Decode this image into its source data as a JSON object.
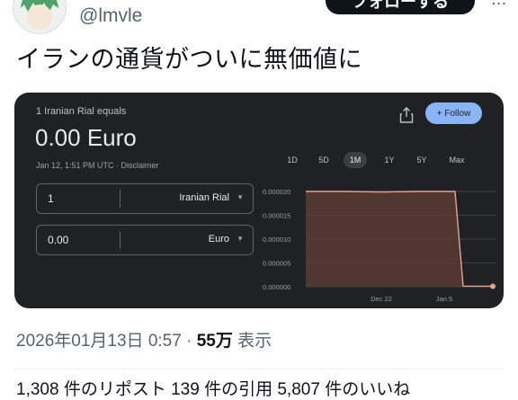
{
  "tweet": {
    "handle": "@lmvle",
    "follow_label": "フォローする",
    "text": "イランの通貨がついに無価値に",
    "timestamp": "2026年01月13日 0:57",
    "dot": "·",
    "views_count": "55万",
    "views_label": "表示",
    "stats_partial": "1,308 件のリポスト 139 件の引用 5,807 件のいいね"
  },
  "card": {
    "subtitle": "1 Iranian Rial equals",
    "value": "0.00 Euro",
    "date_line": "Jan 12, 1:51 PM UTC · Disclaimer",
    "follow_label": "+ Follow",
    "ranges": [
      "1D",
      "5D",
      "1M",
      "1Y",
      "5Y",
      "Max"
    ],
    "active_range": "1M",
    "from": {
      "amount": "1",
      "currency": "Iranian Rial"
    },
    "to": {
      "amount": "0.00",
      "currency": "Euro"
    },
    "colors": {
      "background": "#202124",
      "line": "#e8a38d",
      "fill": "#5a3b35",
      "accent": "#8ab4f8"
    }
  },
  "chart_data": {
    "type": "line",
    "title": "",
    "ylabel": "",
    "xlabel": "",
    "y_ticks": [
      "0.000020",
      "0.000015",
      "0.000010",
      "0.000005",
      "0.000000"
    ],
    "ylim": [
      0,
      2e-05
    ],
    "x_ticks": [
      "Dec 22",
      "Jan 5"
    ],
    "series": [
      {
        "values": [
          {
            "x": "Dec 12",
            "y": 2e-05
          },
          {
            "x": "Dec 18",
            "y": 2e-05
          },
          {
            "x": "Dec 24",
            "y": 1.99e-05
          },
          {
            "x": "Dec 30",
            "y": 2e-05
          },
          {
            "x": "Jan 5",
            "y": 2e-05
          },
          {
            "x": "Jan 7",
            "y": 2e-05
          },
          {
            "x": "Jan 8",
            "y": 1e-07
          },
          {
            "x": "Jan 12",
            "y": 1e-07
          }
        ]
      }
    ],
    "grid": true
  }
}
